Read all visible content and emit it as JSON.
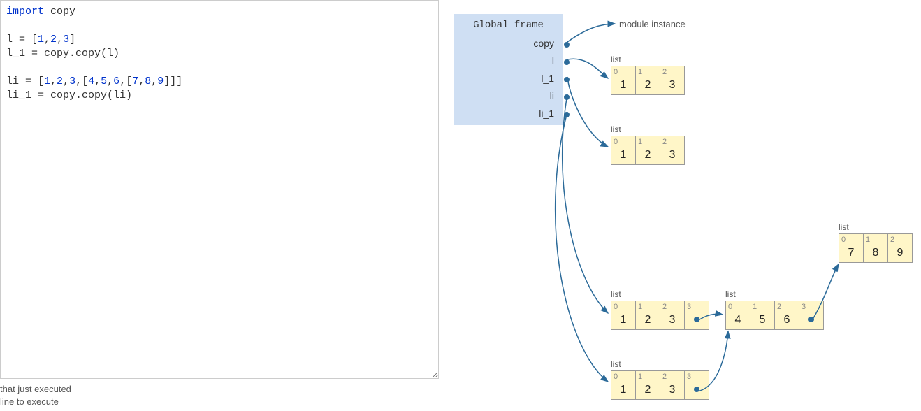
{
  "code": {
    "line1_kw": "import",
    "line1_mod": " copy",
    "line3_a": "l = [",
    "line3_n1": "1",
    "line3_c1": ",",
    "line3_n2": "2",
    "line3_c2": ",",
    "line3_n3": "3",
    "line3_b": "]",
    "line4": "l_1 = copy.copy(l)",
    "line6_a": "li = [",
    "line6_n1": "1",
    "line6_c1": ",",
    "line6_n2": "2",
    "line6_c2": ",",
    "line6_n3": "3",
    "line6_c3": ",[",
    "line6_n4": "4",
    "line6_c4": ",",
    "line6_n5": "5",
    "line6_c5": ",",
    "line6_n6": "6",
    "line6_c6": ",[",
    "line6_n7": "7",
    "line6_c7": ",",
    "line6_n8": "8",
    "line6_c8": ",",
    "line6_n9": "9",
    "line6_b": "]]]",
    "line7": "li_1 = copy.copy(li)"
  },
  "legend": {
    "line1": "that just executed",
    "line2": "line to execute"
  },
  "frame": {
    "title": "Global frame",
    "vars": [
      "copy",
      "l",
      "l_1",
      "li",
      "li_1"
    ]
  },
  "heap": {
    "module_label": "module instance",
    "list_label": "list",
    "list_l": {
      "idx": [
        "0",
        "1",
        "2"
      ],
      "val": [
        "1",
        "2",
        "3"
      ]
    },
    "list_l1": {
      "idx": [
        "0",
        "1",
        "2"
      ],
      "val": [
        "1",
        "2",
        "3"
      ]
    },
    "list_li": {
      "idx": [
        "0",
        "1",
        "2",
        "3"
      ],
      "val": [
        "1",
        "2",
        "3",
        ""
      ]
    },
    "list_li1": {
      "idx": [
        "0",
        "1",
        "2",
        "3"
      ],
      "val": [
        "1",
        "2",
        "3",
        ""
      ]
    },
    "list_in1": {
      "idx": [
        "0",
        "1",
        "2",
        "3"
      ],
      "val": [
        "4",
        "5",
        "6",
        ""
      ]
    },
    "list_in2": {
      "idx": [
        "0",
        "1",
        "2"
      ],
      "val": [
        "7",
        "8",
        "9"
      ]
    }
  }
}
